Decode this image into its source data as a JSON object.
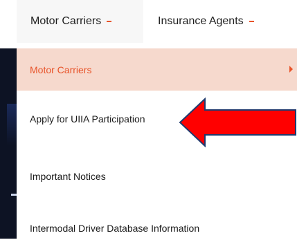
{
  "topnav": {
    "items": [
      {
        "label": "Motor Carriers",
        "state": "active"
      },
      {
        "label": "Insurance Agents"
      }
    ]
  },
  "menu": {
    "items": [
      {
        "label": "Motor Carriers",
        "has_submenu": true,
        "state": "highlighted"
      },
      {
        "label": "Apply for UIIA Participation"
      },
      {
        "label": "Important Notices"
      },
      {
        "label": "Intermodal Driver Database Information"
      }
    ]
  },
  "annotation": {
    "type": "red-arrow",
    "points_to": "menu-item-apply-uiia"
  },
  "colors": {
    "accent": "#e8542a",
    "highlight_bg": "#f6d9cd",
    "arrow_fill": "#ff0000",
    "arrow_stroke": "#1f3a6e",
    "side_band": "#0d1324"
  }
}
